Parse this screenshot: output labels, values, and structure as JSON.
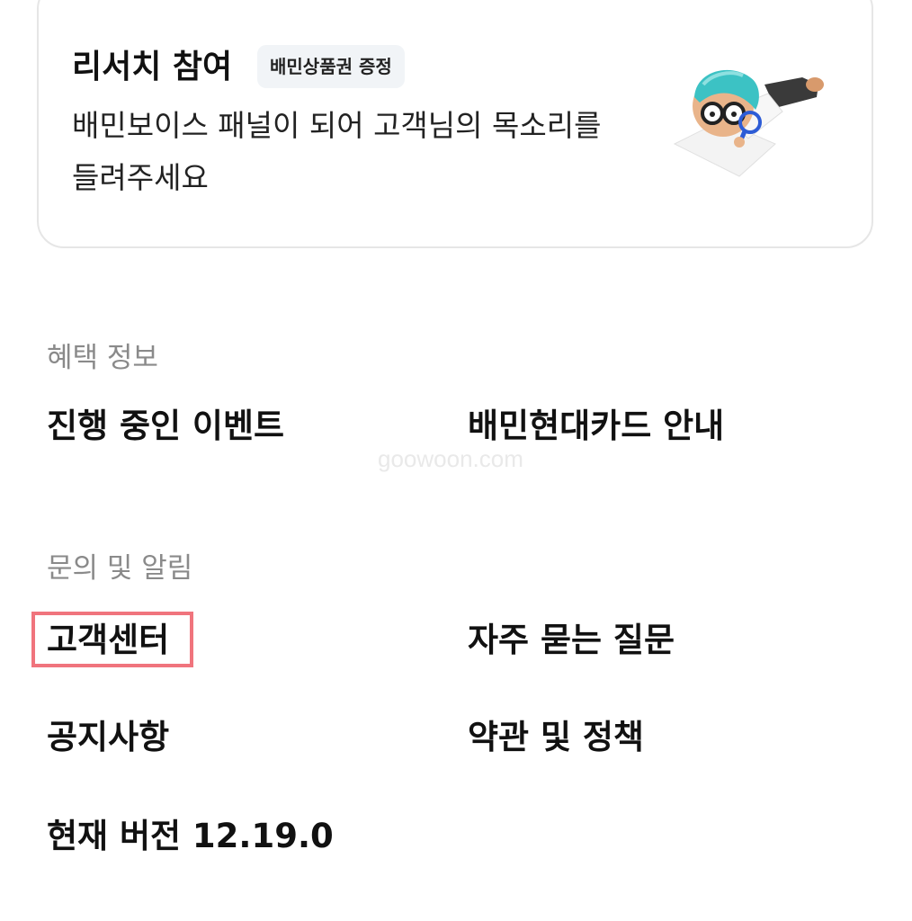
{
  "research_card": {
    "title": "리서치 참여",
    "badge": "배민상품권 증정",
    "description_line1": "배민보이스 패널이 되어 고객님의 목소리를",
    "description_line2": "들려주세요",
    "illustration": "researcher-with-magnifier-character"
  },
  "benefits": {
    "title": "혜택 정보",
    "items": [
      {
        "label": "진행 중인 이벤트"
      },
      {
        "label": "배민현대카드 안내"
      }
    ]
  },
  "support": {
    "title": "문의 및 알림",
    "items": [
      {
        "label": "고객센터"
      },
      {
        "label": "자주 묻는 질문"
      },
      {
        "label": "공지사항"
      },
      {
        "label": "약관 및 정책"
      }
    ]
  },
  "version": {
    "label": "현재 버전 12.19.0"
  },
  "watermark": "goowoon.com",
  "colors": {
    "highlight": "#f0747d",
    "badge_bg": "#f1f4f7",
    "section_title": "#8a8a8a",
    "character_hair": "#3cc2c4"
  }
}
